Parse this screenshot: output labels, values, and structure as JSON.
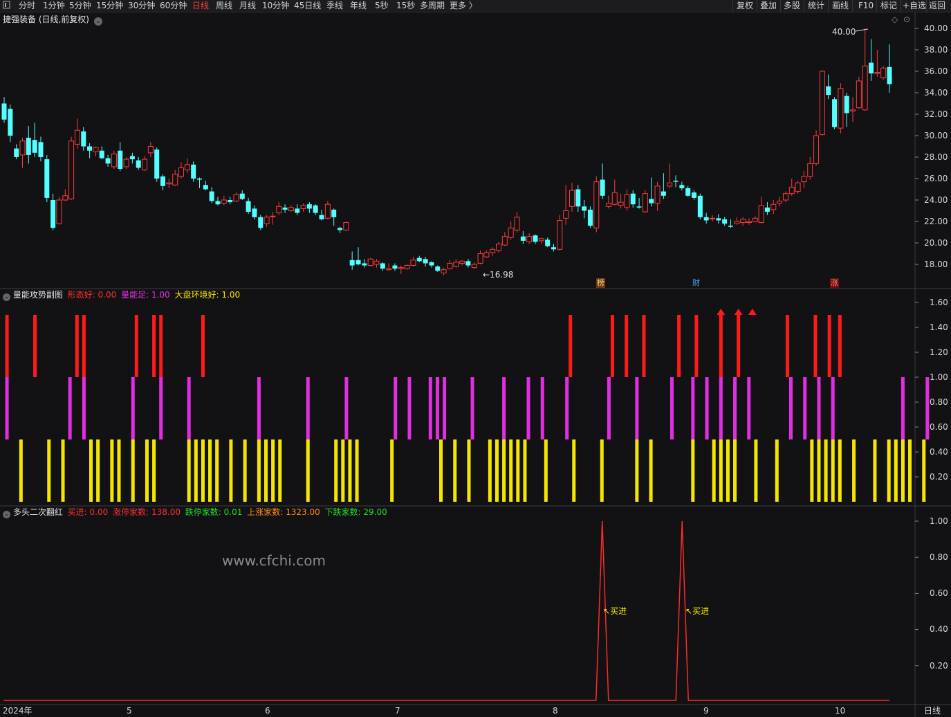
{
  "toolbar": {
    "left_icon": "square-icon",
    "periods": [
      "分时",
      "1分钟",
      "5分钟",
      "15分钟",
      "30分钟",
      "60分钟",
      "日线",
      "周线",
      "月线",
      "10分钟",
      "45日线",
      "季线",
      "年线",
      "5秒",
      "15秒",
      "多周期",
      "更多 〉"
    ],
    "active_period": "日线",
    "right_buttons": [
      "复权",
      "叠加",
      "多股",
      "统计",
      "画线",
      "F10",
      "标记",
      "+自选",
      "返回"
    ]
  },
  "main_panel": {
    "title": "捷强装备 (日线,前复权)",
    "high_label": "40.00",
    "low_label": "←16.98",
    "markers": [
      "榜",
      "财",
      "涨"
    ],
    "y_ticks": [
      "40.00",
      "38.00",
      "36.00",
      "34.00",
      "32.00",
      "30.00",
      "28.00",
      "26.00",
      "24.00",
      "22.00",
      "20.00",
      "18.00"
    ]
  },
  "panel2": {
    "name": "量能攻势副图",
    "items": [
      {
        "label": "形态好:",
        "value": "0.00",
        "color": "#ff3030"
      },
      {
        "label": "量能足:",
        "value": "1.00",
        "color": "#e22ee2"
      },
      {
        "label": "大盘环境好:",
        "value": "1.00",
        "color": "#f5e600"
      }
    ],
    "y_ticks": [
      "1.60",
      "1.40",
      "1.20",
      "1.00",
      "0.80",
      "0.60",
      "0.40",
      "0.20"
    ]
  },
  "panel3": {
    "name": "多头二次翻红",
    "items": [
      {
        "label": "买进:",
        "value": "0.00",
        "color": "#ff3030"
      },
      {
        "label": "涨停家数:",
        "value": "138.00",
        "color": "#ff3030"
      },
      {
        "label": "跌停家数:",
        "value": "0.01",
        "color": "#22dd22"
      },
      {
        "label": "上涨家数:",
        "value": "1323.00",
        "color": "#ff8c1a"
      },
      {
        "label": "下跌家数:",
        "value": "29.00",
        "color": "#22dd22"
      }
    ],
    "buy_label": "买进",
    "y_ticks": [
      "1.00",
      "0.80",
      "0.60",
      "0.40",
      "0.20"
    ]
  },
  "watermark": "www.cfchi.com",
  "x_axis": {
    "labels": [
      "2024年",
      "5",
      "6",
      "7",
      "8",
      "9",
      "10"
    ],
    "right_label": "日线"
  },
  "chart_data": {
    "type": "candlestick",
    "ylim": [
      16.5,
      41
    ],
    "candles": [
      [
        33.0,
        31.5,
        33.6,
        31.2
      ],
      [
        32.5,
        30.0,
        32.9,
        29.4
      ],
      [
        28.8,
        28.0,
        29.2,
        27.8
      ],
      [
        28.2,
        29.5,
        29.8,
        27.0
      ],
      [
        29.8,
        28.2,
        30.9,
        27.4
      ],
      [
        29.6,
        28.4,
        31.2,
        28.0
      ],
      [
        29.4,
        28.0,
        29.9,
        27.6
      ],
      [
        27.8,
        24.2,
        28.2,
        23.8
      ],
      [
        24.0,
        21.4,
        24.6,
        21.2
      ],
      [
        21.8,
        24.0,
        24.3,
        21.7
      ],
      [
        24.0,
        24.4,
        25.0,
        23.9
      ],
      [
        24.1,
        29.5,
        29.9,
        24.0
      ],
      [
        29.2,
        30.5,
        31.6,
        28.8
      ],
      [
        30.4,
        29.0,
        30.8,
        28.6
      ],
      [
        29.0,
        28.6,
        29.3,
        27.9
      ],
      [
        28.5,
        28.9,
        29.0,
        28.1
      ],
      [
        28.6,
        27.9,
        29.0,
        27.8
      ],
      [
        27.9,
        27.4,
        28.2,
        27.1
      ],
      [
        27.1,
        28.3,
        28.6,
        26.9
      ],
      [
        28.6,
        26.9,
        29.4,
        26.7
      ],
      [
        27.1,
        27.8,
        28.0,
        26.9
      ],
      [
        28.1,
        27.8,
        28.4,
        27.4
      ],
      [
        27.7,
        27.0,
        28.0,
        26.8
      ],
      [
        26.8,
        27.8,
        28.1,
        26.7
      ],
      [
        28.4,
        29.0,
        29.4,
        28.0
      ],
      [
        28.7,
        26.0,
        28.9,
        25.7
      ],
      [
        26.2,
        25.3,
        26.4,
        24.9
      ],
      [
        25.5,
        25.6,
        26.0,
        25.1
      ],
      [
        25.4,
        26.4,
        26.8,
        25.3
      ],
      [
        26.2,
        27.0,
        27.5,
        26.0
      ],
      [
        26.8,
        27.3,
        27.9,
        26.5
      ],
      [
        27.3,
        26.0,
        27.6,
        25.7
      ],
      [
        26.0,
        25.9,
        26.1,
        25.1
      ],
      [
        25.4,
        25.0,
        25.8,
        24.9
      ],
      [
        24.8,
        23.9,
        25.2,
        23.7
      ],
      [
        23.9,
        23.6,
        24.3,
        23.5
      ],
      [
        23.7,
        24.0,
        24.4,
        23.5
      ],
      [
        24.0,
        23.8,
        24.3,
        23.6
      ],
      [
        23.9,
        24.5,
        24.7,
        23.8
      ],
      [
        24.6,
        24.1,
        24.9,
        24.0
      ],
      [
        23.9,
        22.9,
        24.2,
        22.7
      ],
      [
        23.2,
        22.4,
        23.5,
        22.2
      ],
      [
        22.4,
        21.4,
        22.6,
        21.2
      ],
      [
        21.8,
        22.4,
        22.6,
        21.5
      ],
      [
        22.5,
        22.5,
        22.9,
        21.7
      ],
      [
        22.8,
        23.4,
        23.8,
        22.6
      ],
      [
        23.3,
        23.1,
        23.6,
        22.8
      ],
      [
        23.0,
        23.3,
        23.5,
        22.9
      ],
      [
        23.2,
        22.8,
        23.6,
        22.6
      ],
      [
        23.2,
        23.5,
        23.7,
        22.9
      ],
      [
        23.6,
        23.2,
        23.8,
        22.8
      ],
      [
        23.5,
        22.8,
        23.6,
        22.6
      ],
      [
        22.6,
        22.2,
        23.1,
        22.1
      ],
      [
        22.3,
        23.6,
        23.9,
        22.2
      ],
      [
        23.1,
        22.4,
        23.2,
        21.6
      ],
      [
        21.4,
        21.2,
        21.5,
        20.9
      ],
      [
        21.2,
        21.9,
        22.0,
        21.1
      ],
      [
        18.4,
        17.9,
        19.2,
        17.5
      ],
      [
        18.4,
        18.0,
        19.6,
        17.9
      ],
      [
        18.1,
        17.9,
        18.5,
        17.7
      ],
      [
        17.9,
        18.5,
        18.6,
        17.8
      ],
      [
        18.0,
        18.3,
        18.5,
        17.7
      ],
      [
        18.1,
        17.6,
        18.2,
        17.4
      ],
      [
        17.5,
        17.6,
        18.1,
        17.4
      ],
      [
        17.9,
        17.6,
        18.1,
        17.4
      ],
      [
        17.6,
        17.7,
        17.9,
        17.1
      ],
      [
        17.6,
        17.9,
        18.0,
        17.5
      ],
      [
        17.9,
        18.4,
        18.7,
        17.8
      ],
      [
        18.6,
        18.3,
        18.8,
        18.2
      ],
      [
        18.5,
        18.1,
        18.7,
        17.8
      ],
      [
        18.2,
        17.9,
        18.3,
        17.7
      ],
      [
        17.8,
        17.4,
        17.9,
        17.3
      ],
      [
        17.2,
        17.5,
        17.7,
        16.98
      ],
      [
        17.6,
        18.1,
        18.4,
        17.5
      ],
      [
        17.8,
        18.2,
        18.5,
        17.7
      ],
      [
        18.1,
        18.3,
        18.4,
        17.9
      ],
      [
        18.3,
        17.9,
        18.5,
        17.7
      ],
      [
        17.7,
        18.0,
        18.2,
        17.6
      ],
      [
        18.1,
        19.0,
        19.3,
        18.0
      ],
      [
        18.7,
        19.1,
        19.3,
        18.6
      ],
      [
        19.1,
        19.4,
        19.6,
        18.8
      ],
      [
        19.3,
        19.9,
        20.1,
        19.1
      ],
      [
        19.8,
        20.6,
        21.0,
        19.7
      ],
      [
        20.5,
        21.4,
        22.0,
        20.3
      ],
      [
        21.2,
        22.4,
        22.9,
        21.0
      ],
      [
        20.6,
        20.2,
        21.1,
        19.9
      ],
      [
        20.1,
        20.6,
        20.9,
        19.9
      ],
      [
        20.7,
        20.1,
        20.8,
        19.9
      ],
      [
        20.2,
        20.4,
        20.5,
        19.9
      ],
      [
        20.3,
        19.7,
        20.5,
        19.6
      ],
      [
        19.6,
        19.4,
        19.9,
        19.2
      ],
      [
        19.4,
        22.1,
        22.6,
        19.3
      ],
      [
        22.3,
        23.0,
        25.4,
        21.7
      ],
      [
        23.4,
        24.9,
        25.6,
        22.9
      ],
      [
        25.0,
        23.4,
        25.4,
        22.9
      ],
      [
        23.4,
        23.0,
        24.0,
        22.3
      ],
      [
        23.1,
        21.6,
        23.4,
        21.4
      ],
      [
        21.4,
        25.7,
        26.2,
        21.0
      ],
      [
        25.9,
        24.4,
        27.4,
        24.1
      ],
      [
        23.4,
        23.7,
        24.4,
        23.2
      ],
      [
        23.6,
        24.7,
        25.9,
        23.5
      ],
      [
        23.5,
        23.8,
        24.6,
        23.2
      ],
      [
        23.3,
        24.5,
        25.0,
        23.0
      ],
      [
        24.6,
        23.6,
        24.9,
        23.3
      ],
      [
        23.4,
        23.3,
        24.2,
        23.2
      ],
      [
        22.9,
        24.6,
        24.9,
        22.8
      ],
      [
        24.1,
        23.7,
        26.1,
        23.4
      ],
      [
        23.7,
        25.3,
        25.7,
        23.0
      ],
      [
        24.8,
        24.4,
        26.5,
        24.1
      ],
      [
        25.3,
        25.6,
        27.4,
        25.1
      ],
      [
        25.8,
        25.7,
        26.3,
        25.2
      ],
      [
        25.4,
        25.1,
        25.7,
        24.9
      ],
      [
        25.1,
        24.4,
        25.3,
        24.3
      ],
      [
        24.7,
        24.2,
        24.9,
        24.0
      ],
      [
        24.4,
        22.4,
        24.6,
        22.2
      ],
      [
        22.4,
        22.1,
        22.8,
        21.8
      ],
      [
        22.3,
        22.3,
        22.6,
        22.0
      ],
      [
        22.3,
        22.1,
        22.7,
        21.8
      ],
      [
        22.2,
        21.8,
        22.4,
        21.6
      ],
      [
        21.6,
        21.5,
        22.2,
        21.4
      ],
      [
        21.8,
        22.0,
        22.4,
        21.7
      ],
      [
        21.9,
        22.2,
        22.4,
        21.6
      ],
      [
        21.9,
        22.0,
        22.3,
        21.7
      ],
      [
        22.0,
        22.3,
        22.5,
        21.9
      ],
      [
        21.9,
        23.5,
        24.3,
        21.8
      ],
      [
        23.3,
        22.9,
        23.8,
        22.6
      ],
      [
        23.1,
        23.6,
        24.0,
        22.7
      ],
      [
        23.7,
        23.9,
        24.3,
        23.4
      ],
      [
        24.0,
        24.6,
        24.8,
        23.8
      ],
      [
        24.6,
        25.2,
        26.0,
        24.4
      ],
      [
        24.8,
        25.6,
        25.8,
        24.6
      ],
      [
        25.7,
        26.2,
        26.7,
        25.1
      ],
      [
        26.2,
        27.4,
        28.0,
        25.9
      ],
      [
        27.4,
        30.0,
        30.5,
        27.2
      ],
      [
        30.1,
        36.0,
        36.1,
        30.0
      ],
      [
        34.6,
        33.8,
        35.7,
        33.4
      ],
      [
        33.4,
        30.8,
        33.6,
        30.6
      ],
      [
        30.7,
        34.4,
        34.9,
        30.2
      ],
      [
        33.7,
        32.1,
        34.0,
        30.8
      ],
      [
        32.3,
        32.4,
        33.6,
        31.3
      ],
      [
        32.6,
        35.1,
        35.5,
        32.5
      ],
      [
        32.4,
        36.5,
        40.0,
        32.3
      ],
      [
        36.8,
        35.8,
        39.0,
        35.1
      ],
      [
        35.8,
        35.9,
        38.0,
        35.5
      ],
      [
        35.4,
        36.3,
        36.5,
        35.2
      ],
      [
        36.4,
        34.8,
        38.5,
        34.0
      ]
    ],
    "panel2_bars": {
      "red": [
        1,
        9,
        21,
        23,
        38,
        43,
        45,
        57,
        162,
        174,
        178,
        183,
        193,
        198,
        205,
        210,
        224,
        232,
        236,
        239
      ],
      "magenta": [
        1,
        19,
        23,
        37,
        45,
        53,
        73,
        87,
        98,
        112,
        116,
        122,
        124,
        126,
        134,
        143,
        150,
        154,
        161,
        173,
        181,
        191,
        197,
        201,
        205,
        209,
        213,
        225,
        229,
        233,
        237,
        257,
        264
      ],
      "yellow": [
        5,
        13,
        17,
        25,
        27,
        31,
        33,
        37,
        41,
        43,
        53,
        55,
        57,
        59,
        61,
        65,
        69,
        73,
        75,
        77,
        79,
        87,
        95,
        97,
        99,
        101,
        111,
        125,
        129,
        133,
        139,
        141,
        143,
        145,
        147,
        149,
        155,
        163,
        171,
        181,
        185,
        197,
        203,
        205,
        207,
        209,
        215,
        221,
        231,
        233,
        235,
        237,
        239,
        243,
        249,
        253,
        255,
        257,
        259,
        263
      ],
      "arrows": [
        205,
        210,
        214
      ]
    },
    "panel3_peaks": [
      180,
      204
    ]
  }
}
